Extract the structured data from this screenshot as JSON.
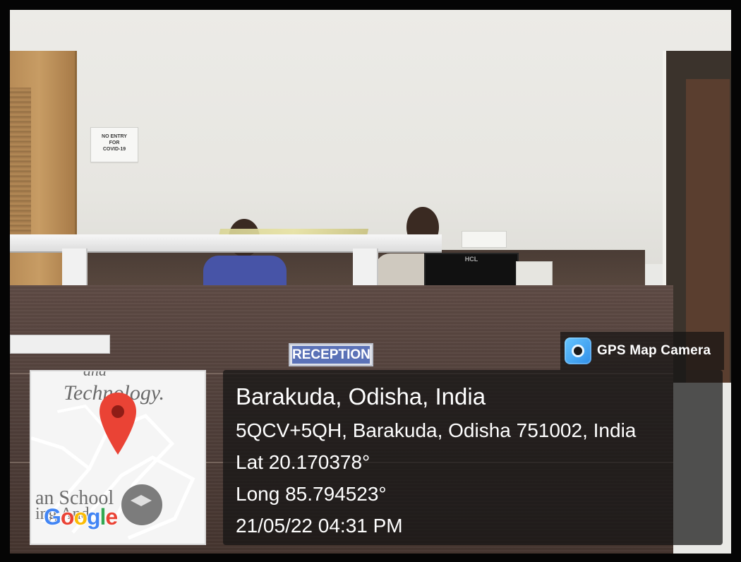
{
  "overlay": {
    "brand": "GPS Map Camera",
    "location_title": "Barakuda, Odisha, India",
    "address": "5QCV+5QH, Barakuda, Odisha 751002, India",
    "latitude": "Lat 20.170378°",
    "longitude": "Long 85.794523°",
    "timestamp": "21/05/22 04:31 PM"
  },
  "map_preview": {
    "top_text": "and\nTechnology.",
    "bottom_text": "an School\ning And",
    "logo_letters": [
      "G",
      "o",
      "o",
      "g",
      "l",
      "e"
    ],
    "pin_color": "#EA4335"
  },
  "scene": {
    "notice_lines": [
      "NO ENTRY",
      "FOR",
      "COVID-19"
    ],
    "reception_sign": "RECEPTION",
    "monitor_brand": "HCL"
  },
  "colors": {
    "counter_wood": "#4d3d38",
    "wall": "#e7e6e1",
    "sign_blue": "#5b72b7",
    "overlay_bg": "rgba(20,20,20,0.72)"
  }
}
